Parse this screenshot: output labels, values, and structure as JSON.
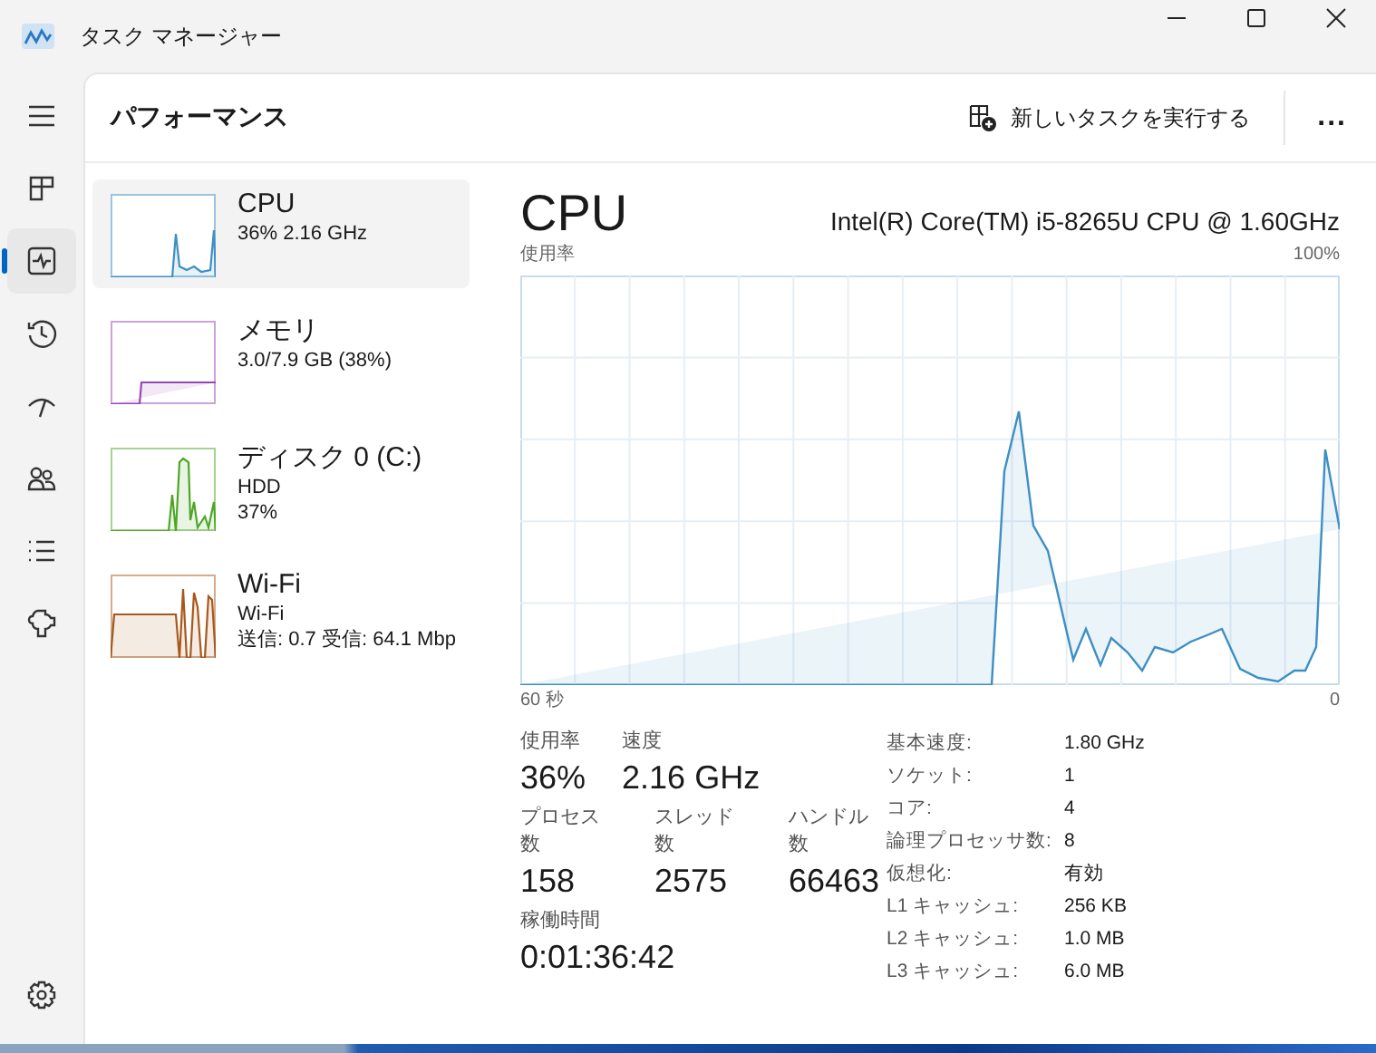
{
  "window": {
    "title": "タスク マネージャー"
  },
  "nav": [
    {
      "selected": false
    },
    {
      "selected": false
    },
    {
      "selected": true
    },
    {
      "selected": false
    },
    {
      "selected": false
    },
    {
      "selected": false
    },
    {
      "selected": false
    },
    {
      "selected": false
    }
  ],
  "header": {
    "title": "パフォーマンス",
    "run_task_button": "新しいタスクを実行する",
    "more_button": "..."
  },
  "devices": [
    {
      "name": "CPU",
      "lines": [
        "36%  2.16 GHz"
      ],
      "selected": true,
      "color": "#3d8fc4"
    },
    {
      "name": "メモリ",
      "lines": [
        "3.0/7.9 GB (38%)"
      ],
      "selected": false,
      "color": "#9b45b5"
    },
    {
      "name": "ディスク 0 (C:)",
      "lines": [
        "HDD",
        "37%"
      ],
      "selected": false,
      "color": "#4da626"
    },
    {
      "name": "Wi-Fi",
      "lines": [
        "Wi-Fi",
        "送信: 0.7 受信: 64.1 Mbp"
      ],
      "selected": false,
      "color": "#a7581b"
    }
  ],
  "detail": {
    "title": "CPU",
    "model": "Intel(R) Core(TM) i5-8265U CPU @ 1.60GHz",
    "graph_label": "使用率",
    "graph_max": "100%",
    "graph_start": "60 秒",
    "graph_end": "0",
    "stats": [
      [
        {
          "label": "使用率",
          "value": "36%"
        },
        {
          "label": "速度",
          "value": "2.16 GHz"
        }
      ],
      [
        {
          "label": "プロセス数",
          "value": "158"
        },
        {
          "label": "スレッド数",
          "value": "2575"
        },
        {
          "label": "ハンドル数",
          "value": "66463"
        }
      ],
      [
        {
          "label": "稼働時間",
          "value": "0:01:36:42"
        }
      ]
    ],
    "properties": [
      {
        "label": "基本速度:",
        "value": "1.80 GHz"
      },
      {
        "label": "ソケット:",
        "value": "1"
      },
      {
        "label": "コア:",
        "value": "4"
      },
      {
        "label": "論理プロセッサ数:",
        "value": "8"
      },
      {
        "label": "仮想化:",
        "value": "有効"
      },
      {
        "label": "L1 キャッシュ:",
        "value": "256 KB"
      },
      {
        "label": "L2 キャッシュ:",
        "value": "1.0 MB"
      },
      {
        "label": "L3 キャッシュ:",
        "value": "6.0 MB"
      }
    ]
  }
}
